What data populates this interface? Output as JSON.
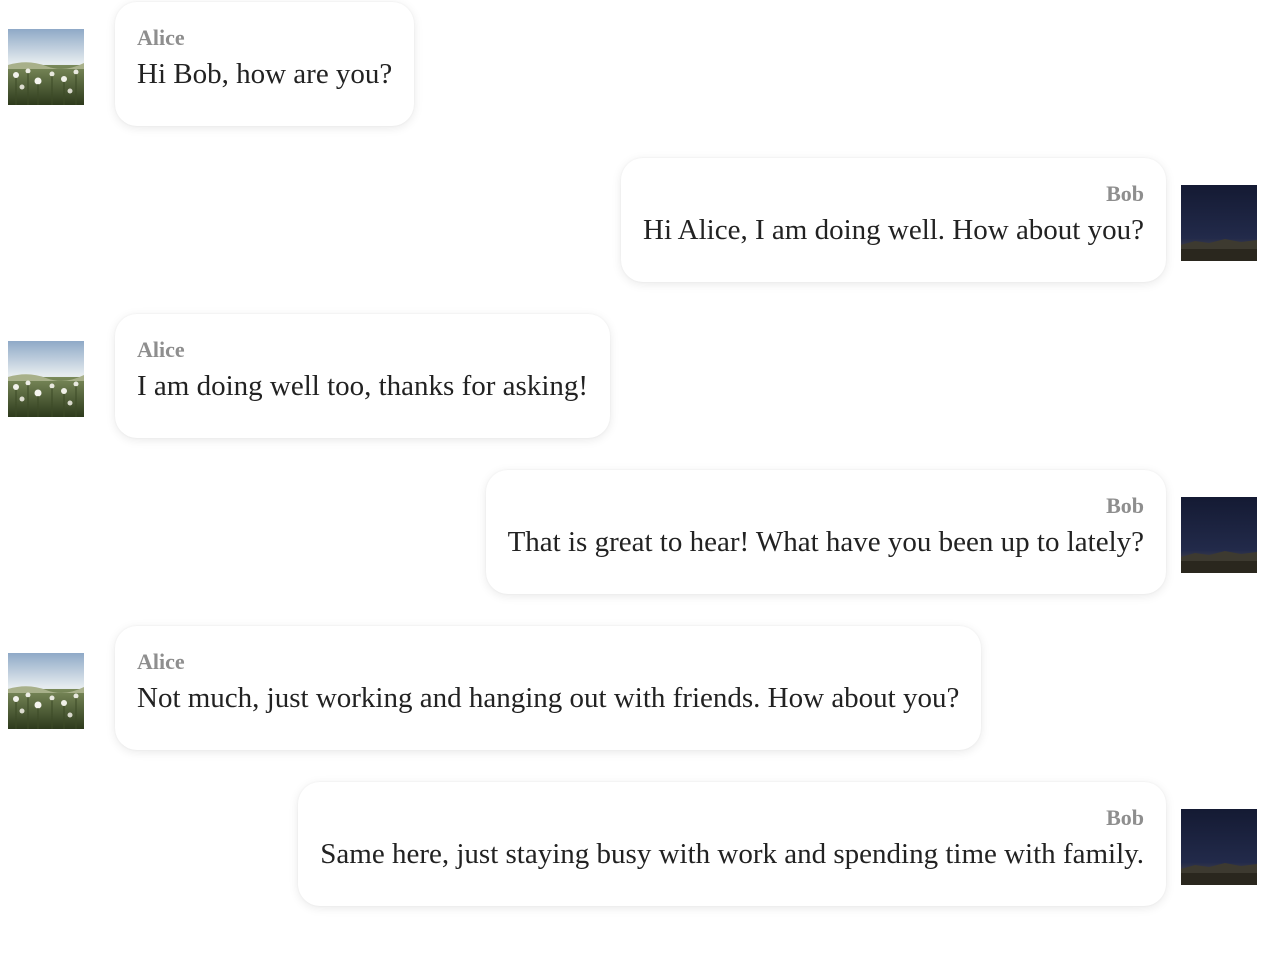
{
  "messages": [
    {
      "side": "left",
      "sender": "Alice",
      "text": "Hi Bob, how are you?",
      "avatar": "meadow-photo"
    },
    {
      "side": "right",
      "sender": "Bob",
      "text": "Hi Alice, I am doing well. How about you?",
      "avatar": "night-sky-photo"
    },
    {
      "side": "left",
      "sender": "Alice",
      "text": "I am doing well too, thanks for asking!",
      "avatar": "meadow-photo"
    },
    {
      "side": "right",
      "sender": "Bob",
      "text": "That is great to hear! What have you been up to lately?",
      "avatar": "night-sky-photo"
    },
    {
      "side": "left",
      "sender": "Alice",
      "text": "Not much, just working and hanging out with friends. How about you?",
      "avatar": "meadow-photo"
    },
    {
      "side": "right",
      "sender": "Bob",
      "text": "Same here, just staying busy with work and spending time with family.",
      "avatar": "night-sky-photo"
    }
  ],
  "colors": {
    "bubble_bg": "#ffffff",
    "sender_text": "#8e8e8e",
    "message_text": "#222222"
  }
}
